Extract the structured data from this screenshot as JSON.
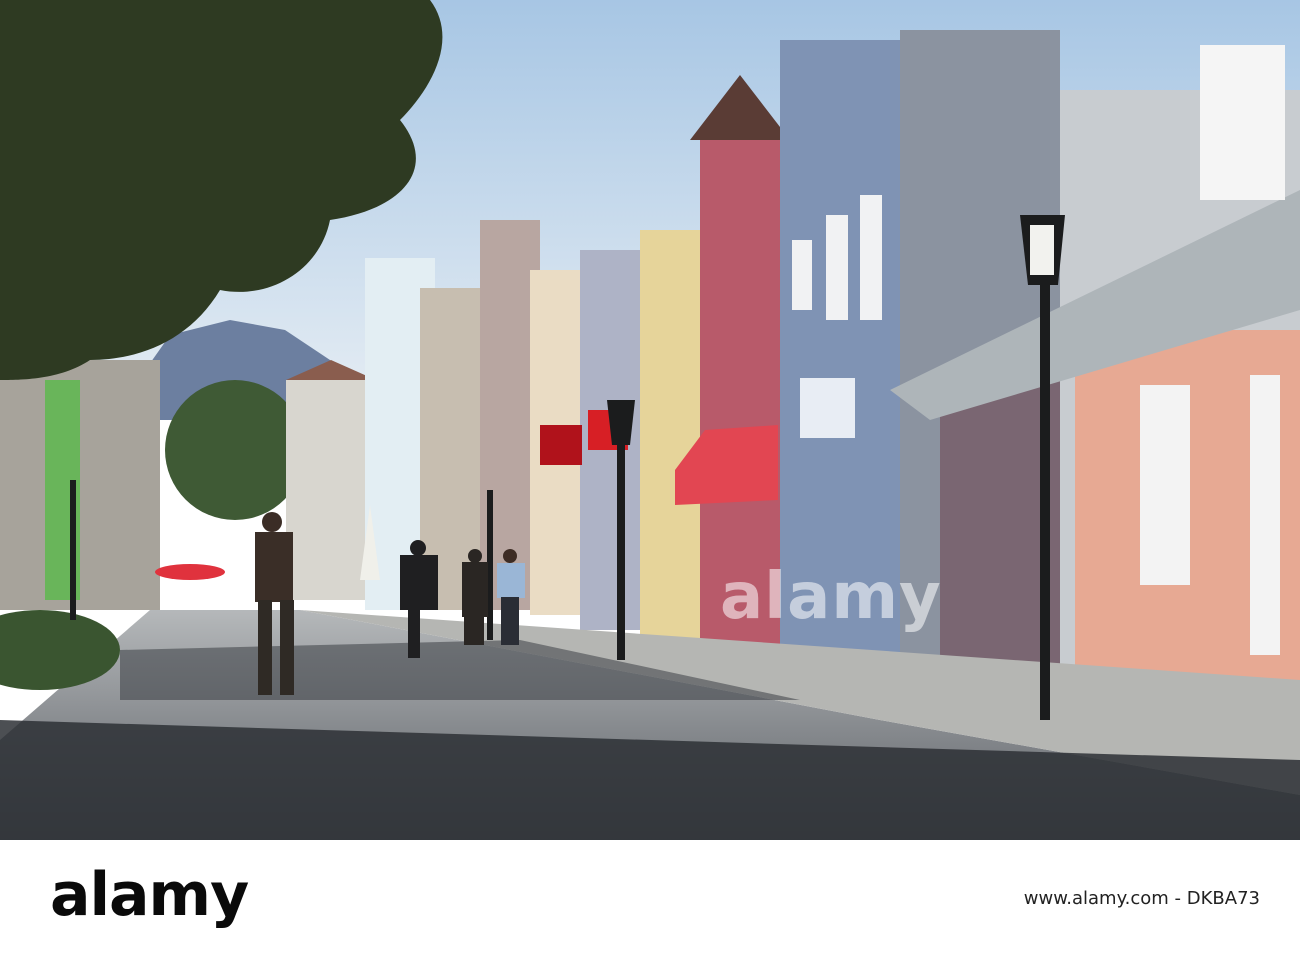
{
  "watermark": {
    "text": "alamy"
  },
  "footer": {
    "logo": "alamy",
    "caption": "www.alamy.com - DKBA73"
  },
  "colors": {
    "sky": "#c9dcec",
    "road": "#5f6670",
    "shadow": "#2d3035",
    "sidewalk": "#a9aaa7",
    "building_blue": "#7f93b4",
    "building_red": "#b85a6a",
    "building_yellow": "#e6d49a",
    "building_pink": "#e7a993",
    "awning": "#e24652",
    "tree": "#2e3a22",
    "lamp": "#1b1c1d"
  }
}
